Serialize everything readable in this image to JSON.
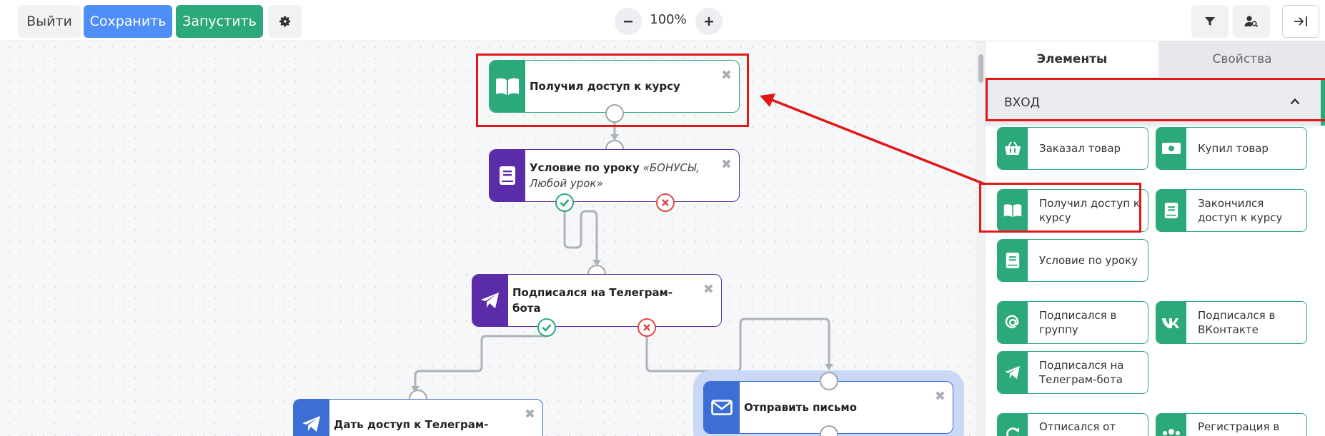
{
  "toolbar": {
    "exit_label": "Выйти",
    "save_label": "Сохранить",
    "run_label": "Запустить",
    "zoom": "100%"
  },
  "nodes": {
    "course_access": {
      "title": "Получил доступ к курсу",
      "color": "#2ca97a"
    },
    "lesson_condition": {
      "title": "Условие по уроку",
      "detail": "«БОНУСЫ, Любой урок»",
      "color": "#5b2ca8"
    },
    "telegram_bot": {
      "title": "Подписался на Телеграм-бота",
      "color": "#5b2ca8"
    },
    "telegram_group": {
      "title": "Дать доступ к Телеграм-группе",
      "color": "#3b6fd6"
    },
    "send_email": {
      "title": "Отправить письмо",
      "color": "#3b6fd6"
    }
  },
  "panel": {
    "tabs": [
      "Элементы",
      "Свойства"
    ],
    "section_title": "ВХОД",
    "cards": [
      {
        "label": "Заказал товар",
        "icon": "basket-icon"
      },
      {
        "label": "Купил товар",
        "icon": "money-icon"
      },
      {
        "label": "Получил доступ к курсу",
        "icon": "book-open-icon"
      },
      {
        "label": "Закончился доступ к курсу",
        "icon": "book-icon"
      },
      {
        "label": "Условие по уроку",
        "icon": "book-icon"
      },
      {
        "label": "Подписался в группу",
        "icon": "at-icon"
      },
      {
        "label": "Подписался в ВКонтакте",
        "icon": "vk-icon"
      },
      {
        "label": "Подписался на Телеграм-бота",
        "icon": "telegram-icon"
      },
      {
        "label": "Отписался от",
        "icon": "refresh-icon"
      },
      {
        "label": "Регистрация в",
        "icon": "users-icon"
      }
    ]
  },
  "colors": {
    "accent_green": "#2ca97a",
    "accent_blue": "#4f8ef7",
    "highlight_red": "#e01818"
  }
}
